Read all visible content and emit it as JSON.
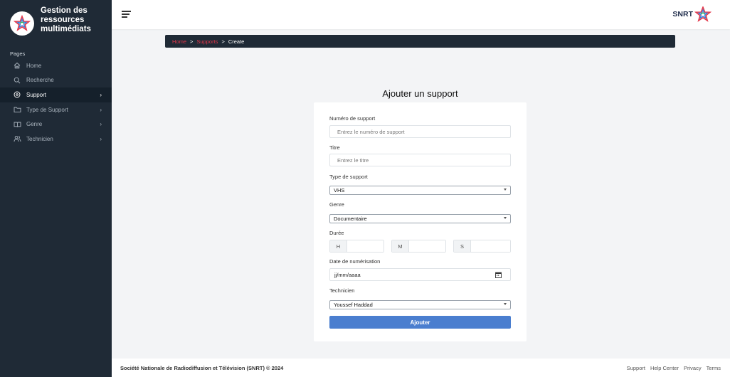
{
  "app": {
    "title": "Gestion des ressources multimédiats",
    "brand": "SNRT"
  },
  "sidebar": {
    "section": "Pages",
    "items": [
      {
        "label": "Home",
        "icon": "home-icon",
        "chevron": ""
      },
      {
        "label": "Recherche",
        "icon": "search-icon",
        "chevron": ""
      },
      {
        "label": "Support",
        "icon": "disc-icon",
        "chevron": "›",
        "active": true
      },
      {
        "label": "Type de Support",
        "icon": "folder-icon",
        "chevron": "›"
      },
      {
        "label": "Genre",
        "icon": "book-icon",
        "chevron": "›"
      },
      {
        "label": "Technicien",
        "icon": "users-icon",
        "chevron": "›"
      }
    ]
  },
  "breadcrumb": {
    "home": "Home",
    "separator": ">",
    "supports": "Supports",
    "current": "Create"
  },
  "form": {
    "title": "Ajouter un support",
    "numero_label": "Numéro de support",
    "numero_placeholder": "Entrez le numéro de support",
    "titre_label": "Titre",
    "titre_placeholder": "Entrez le titre",
    "type_label": "Type de support",
    "type_value": "VHS",
    "genre_label": "Genre",
    "genre_value": "Documentaire",
    "duree_label": "Durée",
    "duree_h": "H",
    "duree_m": "M",
    "duree_s": "S",
    "date_label": "Date de numérisation",
    "date_value": "jj/mm/aaaa",
    "technicien_label": "Technicien",
    "technicien_value": "Youssef Haddad",
    "submit_label": "Ajouter"
  },
  "footer": {
    "copyright": "Société Nationale de Radiodiffusion et Télévision (SNRT) © 2024",
    "links": [
      "Support",
      "Help Center",
      "Privacy",
      "Terms"
    ]
  },
  "colors": {
    "sidebar_bg": "#1f2a36",
    "accent_red": "#e3374a",
    "button_blue": "#4a7ecf"
  }
}
